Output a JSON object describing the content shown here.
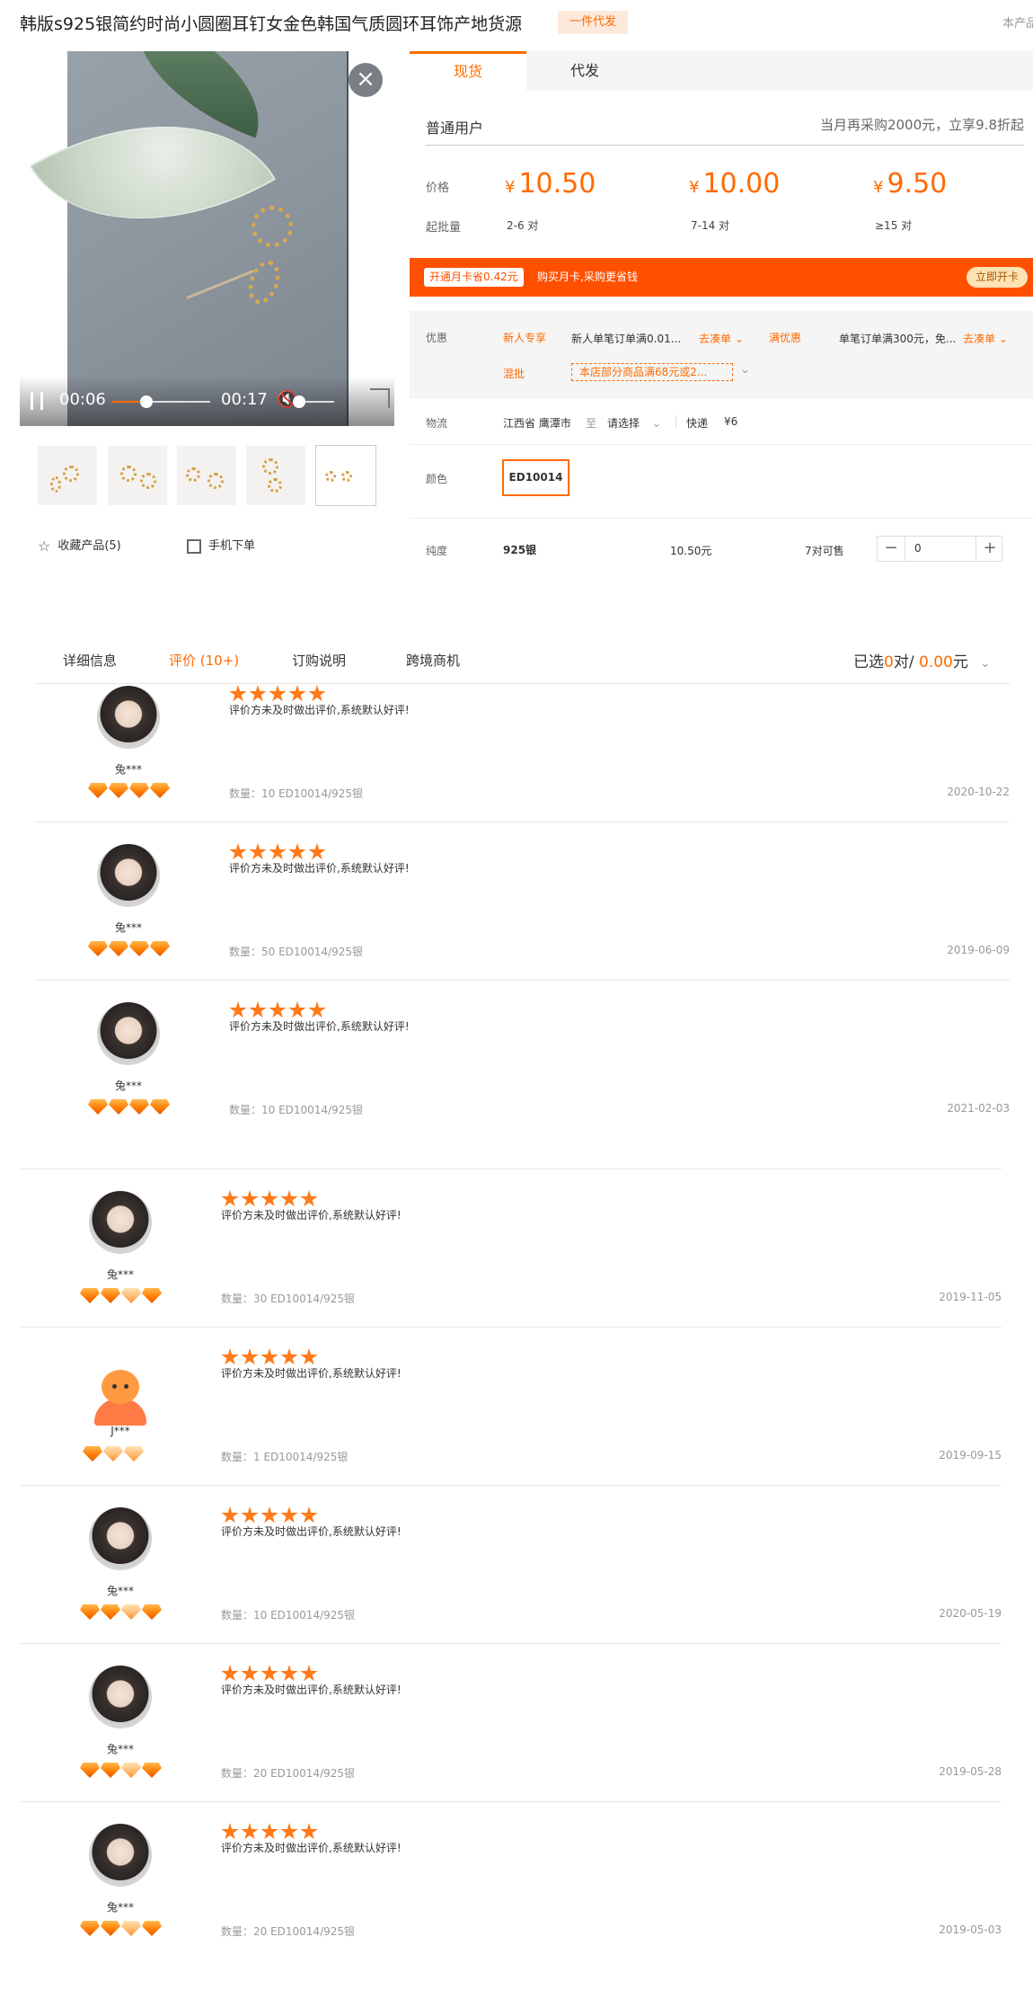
{
  "product": {
    "title": "韩版s925银简约时尚小圆圈耳钉女金色韩国气质圆环耳饰产地货源",
    "badge": "一件代发",
    "corner_text": "本产品"
  },
  "video": {
    "current_time": "00:06",
    "duration": "00:17",
    "progress_fraction": 0.35
  },
  "gallery": {
    "thumb_count": 5,
    "collect_label": "收藏产品(5)",
    "mobile_label": "手机下单"
  },
  "purchase": {
    "tabs": [
      {
        "label": "现货"
      },
      {
        "label": "代发"
      }
    ],
    "user_type": "普通用户",
    "promo_text": "当月再采购2000元，立享9.8折起",
    "price_label": "价格",
    "min_qty_label": "起批量",
    "currency": "¥",
    "tiers": [
      {
        "price": "10.50",
        "qty": "2-6 对"
      },
      {
        "price": "10.00",
        "qty": "7-14 对"
      },
      {
        "price": "9.50",
        "qty": "≥15 对"
      }
    ],
    "card": {
      "tag": "开通月卡省0.42元",
      "text": "购买月卡,采购更省钱",
      "button": "立即开卡"
    },
    "discount": {
      "label": "优惠",
      "new_tag": "新人专享",
      "new_text": "新人单笔订单满0.01...",
      "go_label": "去凑单",
      "full_tag": "满优惠",
      "full_text": "单笔订单满300元，免...",
      "mix_tag": "混批",
      "mix_text": "本店部分商品满68元或2..."
    },
    "logistics": {
      "label": "物流",
      "from": "江西省 鹰潭市",
      "to_word": "至",
      "select": "请选择",
      "method": "快递",
      "fee": "¥6"
    },
    "color": {
      "label": "颜色",
      "value": "ED10014"
    },
    "purity": {
      "label": "纯度",
      "value": "925银",
      "price": "10.50元",
      "stock": "7对可售",
      "quantity": "0"
    }
  },
  "review_tabs": {
    "items": [
      {
        "label": "详细信息"
      },
      {
        "label": "评价 (10+)"
      },
      {
        "label": "订购说明"
      },
      {
        "label": "跨境商机"
      }
    ],
    "selected_prefix": "已选",
    "selected_count": "0",
    "selected_unit": "对/",
    "selected_amount": "0.00",
    "selected_currency": "元"
  },
  "reviews": [
    {
      "user": "兔***",
      "text": "评价方未及时做出评价,系统默认好评!",
      "meta": "数量：10   ED10014/925银",
      "date": "2020-10-22",
      "stars": 5,
      "gems": 4
    },
    {
      "user": "兔***",
      "text": "评价方未及时做出评价,系统默认好评!",
      "meta": "数量：50   ED10014/925银",
      "date": "2019-06-09",
      "stars": 5,
      "gems": 4
    },
    {
      "user": "兔***",
      "text": "评价方未及时做出评价,系统默认好评!",
      "meta": "数量：10   ED10014/925银",
      "date": "2021-02-03",
      "stars": 5,
      "gems": 4
    },
    {
      "user": "兔***",
      "text": "评价方未及时做出评价,系统默认好评!",
      "meta": "数量：30   ED10014/925银",
      "date": "2019-11-05",
      "stars": 5,
      "gems": 4
    },
    {
      "user": "J***",
      "text": "评价方未及时做出评价,系统默认好评!",
      "meta": "数量：1   ED10014/925银",
      "date": "2019-09-15",
      "stars": 5,
      "gems": 3
    },
    {
      "user": "兔***",
      "text": "评价方未及时做出评价,系统默认好评!",
      "meta": "数量：10   ED10014/925银",
      "date": "2020-05-19",
      "stars": 5,
      "gems": 4
    },
    {
      "user": "兔***",
      "text": "评价方未及时做出评价,系统默认好评!",
      "meta": "数量：20   ED10014/925银",
      "date": "2019-05-28",
      "stars": 5,
      "gems": 4
    },
    {
      "user": "兔***",
      "text": "评价方未及时做出评价,系统默认好评!",
      "meta": "数量：20   ED10014/925银",
      "date": "2019-05-03",
      "stars": 5,
      "gems": 4
    }
  ]
}
